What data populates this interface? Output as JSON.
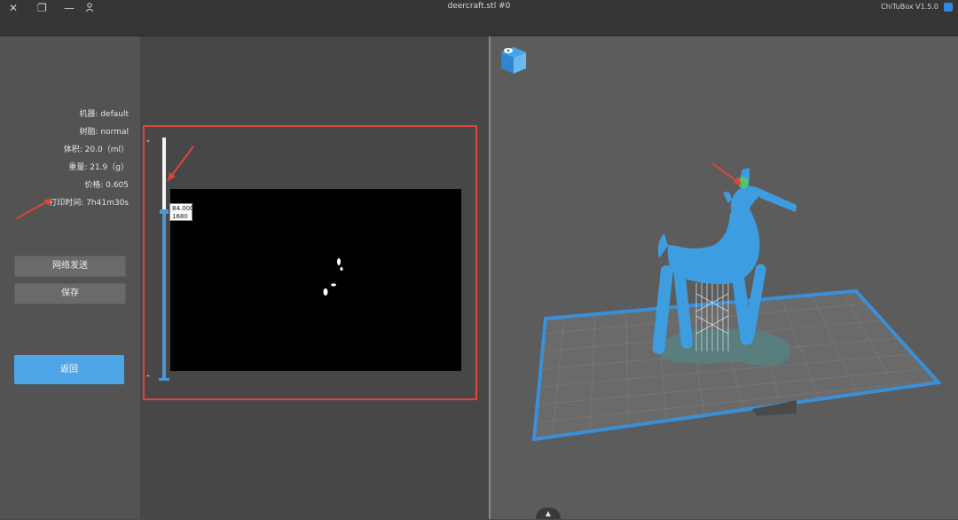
{
  "window": {
    "title": "deercraft.stl #0",
    "app_name": "ChiTuBox V1.5.0",
    "close_icon": "close-icon",
    "minimize_icon": "minimize-icon",
    "restore_icon": "restore-icon",
    "user_icon": "user-icon"
  },
  "info": {
    "machine_label": "机器:",
    "machine_value": "default",
    "resin_label": "树脂:",
    "resin_value": "normal",
    "volume_label": "体积:",
    "volume_value": "20.0（ml）",
    "weight_label": "重量:",
    "weight_value": "21.9（g）",
    "price_label": "价格:",
    "price_value": "0.605",
    "time_label": "打印时间:",
    "time_value": "7h41m30s"
  },
  "buttons": {
    "network_send": "网络发送",
    "save": "保存",
    "back": "返回"
  },
  "slicer": {
    "layer_height": "84.000",
    "layer_number": "1680",
    "up_chevron": "⌄",
    "down_chevron": "⌃"
  },
  "colors": {
    "accent": "#4ea6e6",
    "annotation_red": "#e0453a",
    "model_blue": "#3d9de0"
  }
}
